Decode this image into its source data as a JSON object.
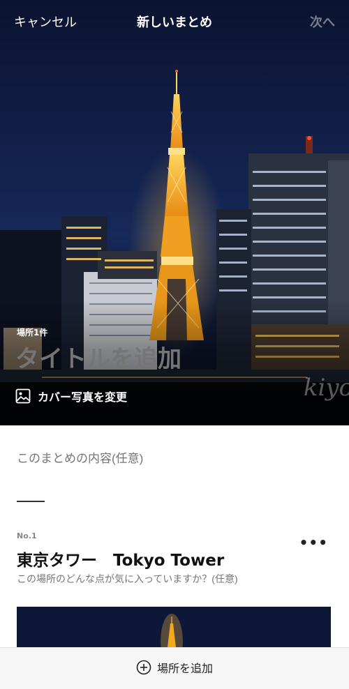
{
  "header": {
    "cancel_label": "キャンセル",
    "title": "新しいまとめ",
    "next_label": "次へ"
  },
  "cover": {
    "place_count": "場所1件",
    "title_placeholder": "タイトルを追加",
    "change_cover_label": "カバー写真を変更",
    "watermark": "kiyo",
    "image_icon": "image-icon"
  },
  "summary": {
    "description_placeholder": "このまとめの内容(任意)"
  },
  "spots": [
    {
      "number": "No.1",
      "name": "東京タワー　Tokyo Tower",
      "note_placeholder": "この場所のどんな点が気に入っていますか？(任意)",
      "menu_icon": "more-dots-icon"
    }
  ],
  "footer": {
    "add_place_label": "場所を追加",
    "add_icon": "plus-circle-icon"
  },
  "colors": {
    "tower": "#f2a81d",
    "sky": "#12204a",
    "accent_text": "#111111"
  }
}
